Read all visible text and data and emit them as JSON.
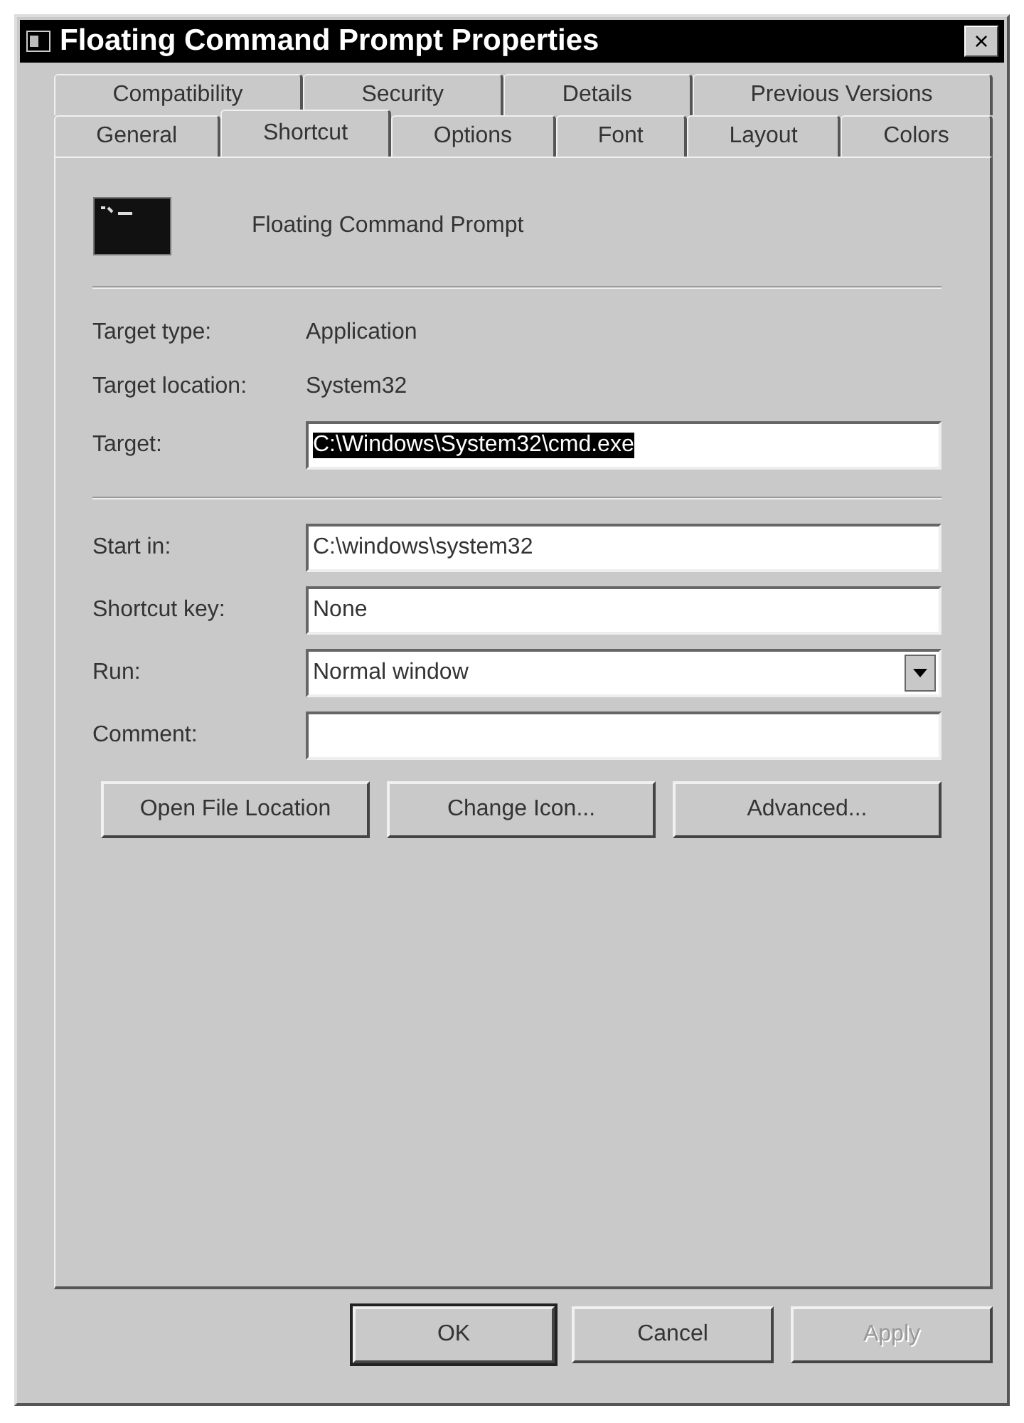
{
  "window": {
    "title": "Floating Command Prompt Properties",
    "close": "×"
  },
  "tab_rows": [
    [
      {
        "label": "Compatibility",
        "selected": false
      },
      {
        "label": "Security",
        "selected": false
      },
      {
        "label": "Details",
        "selected": false
      },
      {
        "label": "Previous Versions",
        "selected": false
      }
    ],
    [
      {
        "label": "General",
        "selected": false
      },
      {
        "label": "Shortcut",
        "selected": true
      },
      {
        "label": "Options",
        "selected": false
      },
      {
        "label": "Font",
        "selected": false
      },
      {
        "label": "Layout",
        "selected": false
      },
      {
        "label": "Colors",
        "selected": false
      }
    ]
  ],
  "shortcut_name": "Floating Command Prompt",
  "info": [
    {
      "label": "Target type:",
      "value": "Application"
    },
    {
      "label": "Target location:",
      "value": "System32"
    }
  ],
  "target": {
    "label": "Target:",
    "value": "C:\\Windows\\System32\\cmd.exe",
    "text_selected": true
  },
  "fields": [
    {
      "kind": "text",
      "label": "Start in:",
      "value": "C:\\windows\\system32"
    },
    {
      "kind": "text",
      "label": "Shortcut key:",
      "value": "None"
    },
    {
      "kind": "dropdown",
      "label": "Run:",
      "value": "Normal window"
    },
    {
      "kind": "text",
      "label": "Comment:"
    }
  ],
  "actions": [
    "Open File Location",
    "Change Icon...",
    "Advanced..."
  ],
  "buttons": [
    {
      "label": "OK",
      "default": true,
      "disabled": false
    },
    {
      "label": "Cancel",
      "default": false,
      "disabled": false
    },
    {
      "label": "Apply",
      "default": false,
      "disabled": true
    }
  ]
}
